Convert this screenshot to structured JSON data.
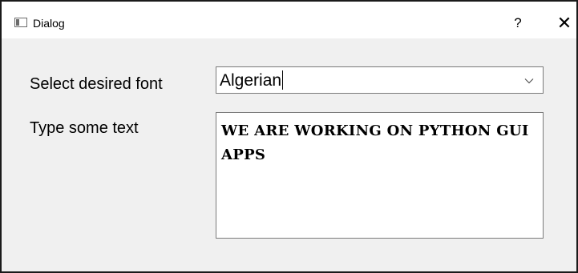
{
  "window": {
    "title": "Dialog",
    "help_glyph": "?",
    "close_glyph": "✕",
    "app_icon": "window-icon"
  },
  "form": {
    "font_label": "Select desired font",
    "font_value": "Algerian",
    "font_dropdown_icon": "chevron-down-icon",
    "text_label": "Type some text",
    "text_value": "WE ARE WORKING ON PYTHON GUI APPS"
  },
  "colors": {
    "titlebar": "#ffffff",
    "body": "#f0f0f0",
    "field_border": "#7a7a7a",
    "window_border": "#1a1a1a"
  }
}
